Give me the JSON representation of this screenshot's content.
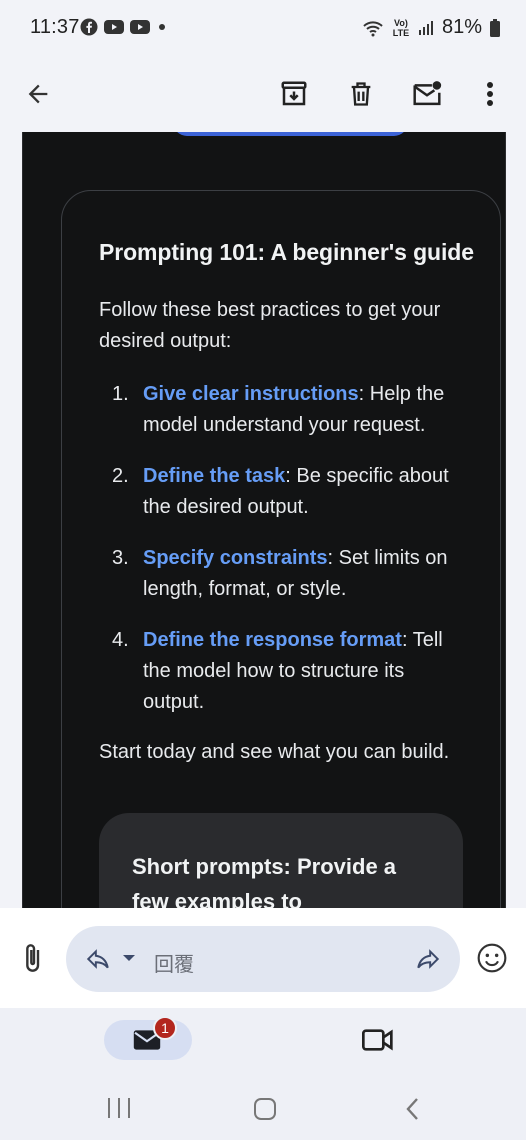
{
  "status": {
    "time": "11:37",
    "app_icons": [
      "facebook-icon",
      "youtube-icon",
      "youtube-icon"
    ],
    "battery": "81%",
    "network": "Vo) LTE"
  },
  "toolbar": {
    "back": "back-arrow-icon",
    "archive": "archive-icon",
    "delete": "trash-icon",
    "mark_unread": "mark-unread-icon",
    "more": "more-vert-icon"
  },
  "email": {
    "card_title": "Prompting 101: A beginner's guide",
    "intro": "Follow these best practices to get your desired output:",
    "items": [
      {
        "num": "1.",
        "keyword": "Give clear instructions",
        "rest": ": Help the model understand your request."
      },
      {
        "num": "2.",
        "keyword": "Define the task",
        "rest": ": Be specific about the desired output."
      },
      {
        "num": "3.",
        "keyword": "Specify constraints",
        "rest": ": Set limits on length, format, or style."
      },
      {
        "num": "4.",
        "keyword": "Define the response format",
        "rest": ": Tell the model how to structure its output."
      }
    ],
    "outro": "Start today and see what you can build.",
    "subcard_title": "Short prompts: Provide a few examples to"
  },
  "reply": {
    "placeholder": "回覆"
  },
  "bottom_nav": {
    "mail_badge": "1"
  },
  "colors": {
    "link": "#669df6",
    "email_bg": "#121314",
    "accent_button": "#3c63d7",
    "badge": "#b3261e"
  }
}
